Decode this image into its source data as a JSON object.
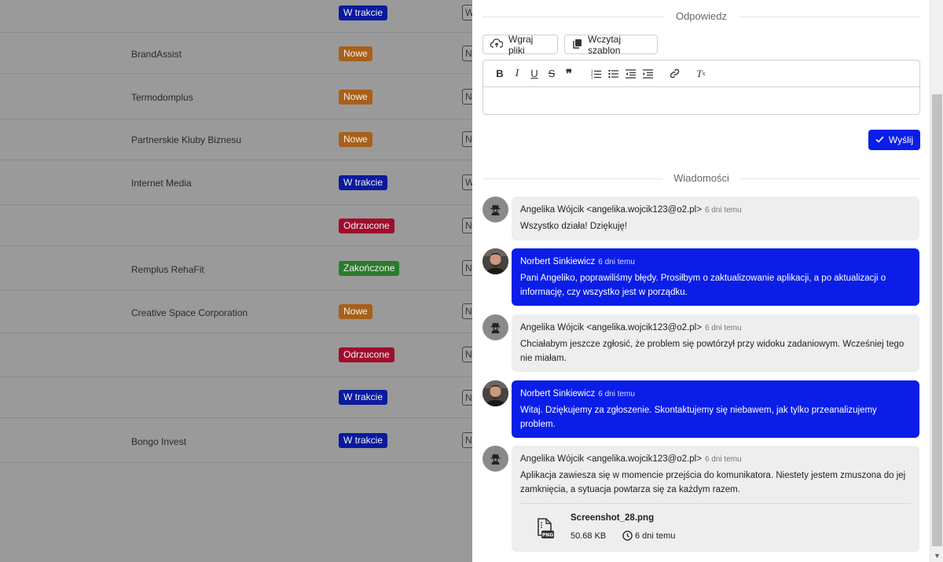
{
  "background_table": {
    "rows": [
      {
        "company": "",
        "status": "W trakcie",
        "status_color": "#0a1a9e",
        "box": "W"
      },
      {
        "company": "BrandAssist",
        "status": "Nowe",
        "status_color": "#a8601a",
        "box": "N"
      },
      {
        "company": "Termodomplus",
        "status": "Nowe",
        "status_color": "#a8601a",
        "box": "N"
      },
      {
        "company": "Partnerskie Kluby Biznesu",
        "status": "Nowe",
        "status_color": "#a8601a",
        "box": "N"
      },
      {
        "company": "Internet Media",
        "status": "W trakcie",
        "status_color": "#0a1a9e",
        "box": "W"
      },
      {
        "company": "",
        "status": "Odrzucone",
        "status_color": "#a00d2c",
        "box": "N"
      },
      {
        "company": "Remplus RehaFit",
        "status": "Zakończone",
        "status_color": "#2d7a2d",
        "box": "N"
      },
      {
        "company": "Creative Space Corporation",
        "status": "Nowe",
        "status_color": "#a8601a",
        "box": "N"
      },
      {
        "company": "",
        "status": "Odrzucone",
        "status_color": "#a00d2c",
        "box": "N"
      },
      {
        "company": "",
        "status": "W trakcie",
        "status_color": "#0a1a9e",
        "box": "N"
      },
      {
        "company": "Bongo Invest",
        "status": "W trakcie",
        "status_color": "#0a1a9e",
        "box": "N"
      }
    ]
  },
  "reply": {
    "title": "Odpowiedz",
    "upload_label": "Wgraj pliki",
    "template_label": "Wczytaj szablon",
    "send_label": "Wyślij",
    "toolbar": [
      "bold-icon",
      "italic-icon",
      "underline-icon",
      "strikethrough-icon",
      "quote-icon",
      "ordered-list-icon",
      "bullet-list-icon",
      "outdent-icon",
      "indent-icon",
      "link-icon",
      "clear-format-icon"
    ]
  },
  "messages": {
    "title": "Wiadomości",
    "items": [
      {
        "author": "Angelika Wójcik <angelika.wojcik123@o2.pl>",
        "time": "6 dni temu",
        "body": "Wszystko działa! Dziękuję!",
        "style": "grey"
      },
      {
        "author": "Norbert Sinkiewicz",
        "time": "6 dni temu",
        "body": "Pani Angeliko, poprawiliśmy błędy. Prosiłbym o zaktualizowanie aplikacji, a po aktualizacji o informację, czy wszystko jest w porządku.",
        "style": "blue"
      },
      {
        "author": "Angelika Wójcik <angelika.wojcik123@o2.pl>",
        "time": "6 dni temu",
        "body": "Chciałabym jeszcze zgłosić, że problem się powtórzył przy widoku zadaniowym. Wcześniej tego nie miałam.",
        "style": "grey"
      },
      {
        "author": "Norbert Sinkiewicz",
        "time": "6 dni temu",
        "body": "Witaj. Dziękujemy za zgłoszenie. Skontaktujemy się niebawem, jak tylko przeanalizujemy problem.",
        "style": "blue"
      },
      {
        "author": "Angelika Wójcik <angelika.wojcik123@o2.pl>",
        "time": "6 dni temu",
        "body": "Aplikacja zawiesza się w momencie przejścia do komunikatora. Niestety jestem zmuszona do jej zamknięcia, a sytuacja powtarza się za każdym razem.",
        "style": "grey",
        "attachment": {
          "name": "Screenshot_28.png",
          "size": "50.68 KB",
          "time": "6 dni temu",
          "type": "PNG"
        }
      }
    ]
  }
}
